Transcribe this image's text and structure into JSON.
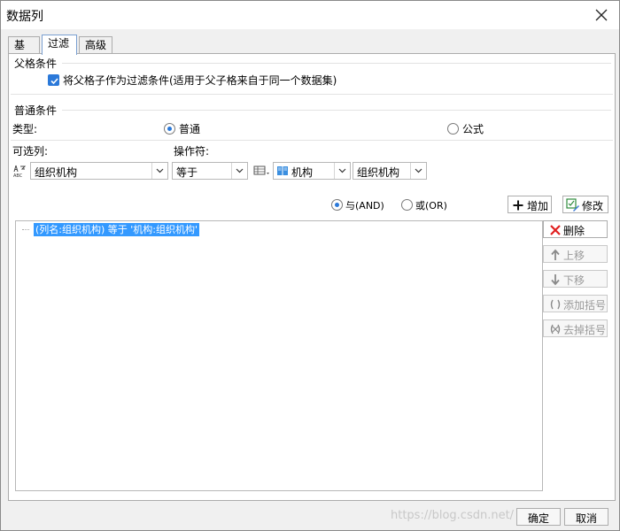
{
  "window": {
    "title": "数据列"
  },
  "tabs": [
    {
      "label": "基本",
      "active": false
    },
    {
      "label": "过滤",
      "active": true
    },
    {
      "label": "高级",
      "active": false
    }
  ],
  "parent_condition": {
    "section_label": "父格条件",
    "checkbox_label": "将父格子作为过滤条件(适用于父子格来自于同一个数据集)",
    "checked": true
  },
  "normal_condition": {
    "section_label": "普通条件",
    "type_label": "类型:",
    "type_options": [
      {
        "label": "普通",
        "selected": true
      },
      {
        "label": "公式",
        "selected": false
      }
    ],
    "column_label": "可选列:",
    "operator_label": "操作符:",
    "column_value": "组织机构",
    "operator_value": "等于",
    "value_type": "机构",
    "value_value": "组织机构"
  },
  "logic": {
    "and_label": "与(AND)",
    "or_label": "或(OR)",
    "selected": "and",
    "add_label": "增加",
    "modify_label": "修改"
  },
  "condition_list": [
    "(列名:组织机构) 等于 '机构:组织机构'"
  ],
  "side_buttons": {
    "delete": "删除",
    "up": "上移",
    "down": "下移",
    "add_bracket": "添加括号",
    "remove_bracket": "去掉括号"
  },
  "footer": {
    "ok": "确定",
    "cancel": "取消",
    "watermark": "https://blog.csdn.net/"
  },
  "colors": {
    "accent": "#2b79d9",
    "selection": "#3399ff",
    "delete_icon": "#e02020"
  },
  "icons": {
    "column": "abc-column-icon",
    "grid": "grid-icon",
    "book": "book-icon",
    "add": "plus-icon",
    "modify": "edit-icon",
    "delete": "x-icon",
    "up": "arrow-up-icon",
    "down": "arrow-down-icon"
  }
}
